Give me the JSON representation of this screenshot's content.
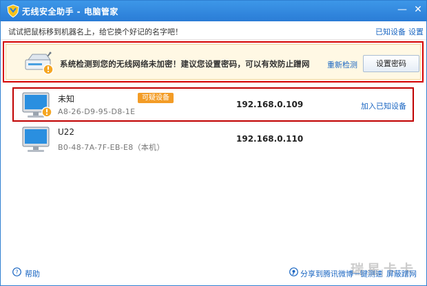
{
  "titlebar": {
    "title": "无线安全助手 - 电脑管家",
    "minimize_glyph": "—",
    "close_glyph": "✕",
    "logo_icon": "shield-logo-icon"
  },
  "hintbar": {
    "hint": "试试把鼠标移到机器名上，给它换个好记的名字吧！",
    "known_devices_link": "已知设备",
    "settings_link": "设置"
  },
  "warning": {
    "message": "系统检测到您的无线网络未加密！建议您设置密码，可以有效防止蹭网",
    "recheck_link": "重新检测",
    "set_password_button": "设置密码",
    "icon": "router-warning-icon"
  },
  "devices": [
    {
      "name": "未知",
      "mac": "A8-26-D9-95-D8-1E",
      "badge": "可疑设备",
      "ip": "192.168.0.109",
      "action": "加入已知设备",
      "icon": "pc-warning-icon"
    },
    {
      "name": "U22",
      "mac": "B0-48-7A-7F-EB-E8（本机）",
      "ip": "192.168.0.110",
      "icon": "pc-icon"
    }
  ],
  "bottombar": {
    "help": "帮助",
    "share": "分享到腾讯微博",
    "speed_test": "一键测速",
    "separator": "|",
    "block": "屏蔽蹭网",
    "watermark": "瑞星卡卡"
  },
  "colors": {
    "titlebar": "#2a7cd6",
    "link": "#1a66c2",
    "highlight_outline": "#d40000",
    "badge": "#f39c26",
    "warning_bg": "#fff8e4"
  }
}
